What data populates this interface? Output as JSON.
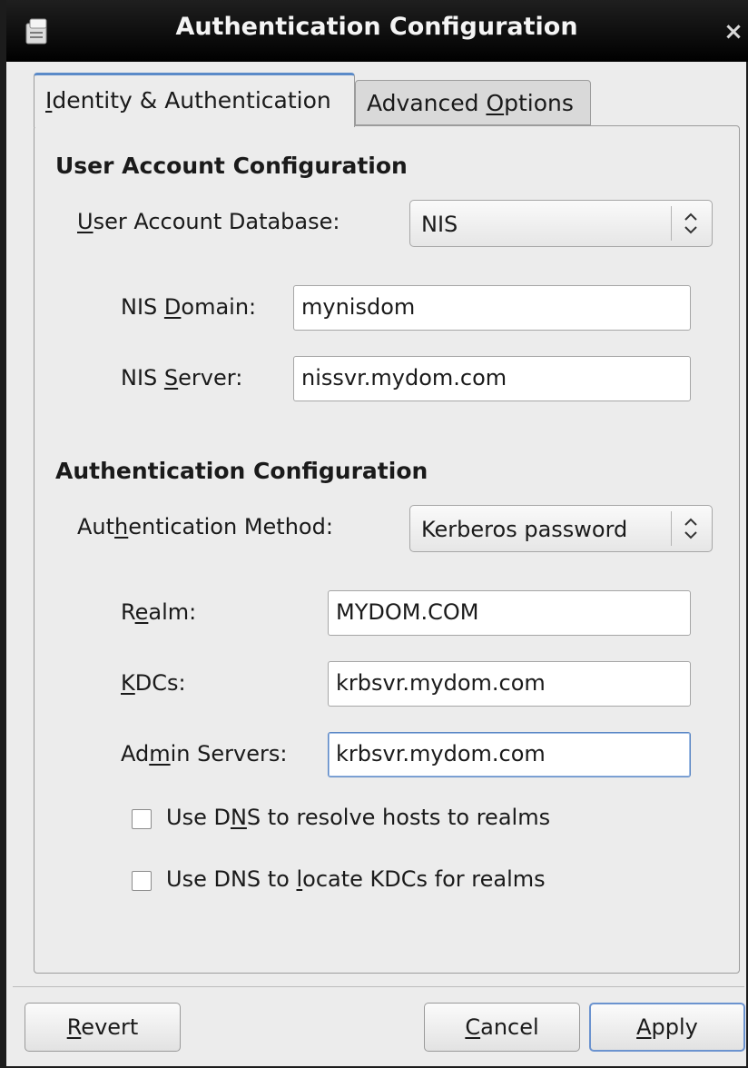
{
  "window": {
    "title": "Authentication Configuration",
    "close_glyph": "×"
  },
  "tabs": [
    {
      "pre": "",
      "key": "I",
      "post": "dentity & Authentication"
    },
    {
      "pre": "Advanced ",
      "key": "O",
      "post": "ptions"
    }
  ],
  "user_account": {
    "section_title": "User Account Configuration",
    "db_label": {
      "pre": "",
      "key": "U",
      "post": "ser Account Database:"
    },
    "db_value": "NIS",
    "nis_domain_label": {
      "pre": "NIS ",
      "key": "D",
      "post": "omain:"
    },
    "nis_domain_value": "mynisdom",
    "nis_server_label": {
      "pre": "NIS ",
      "key": "S",
      "post": "erver:"
    },
    "nis_server_value": "nissvr.mydom.com"
  },
  "authentication": {
    "section_title": "Authentication Configuration",
    "method_label": {
      "pre": "Aut",
      "key": "h",
      "post": "entication Method:"
    },
    "method_value": "Kerberos password",
    "realm_label": {
      "pre": "R",
      "key": "e",
      "post": "alm:"
    },
    "realm_value": "MYDOM.COM",
    "kdcs_label": {
      "pre": "",
      "key": "K",
      "post": "DCs:"
    },
    "kdcs_value": "krbsvr.mydom.com",
    "admin_label": {
      "pre": "Ad",
      "key": "m",
      "post": "in Servers:"
    },
    "admin_value": "krbsvr.mydom.com",
    "dns_realms": {
      "pre": "Use D",
      "key": "N",
      "post": "S to resolve hosts to realms",
      "checked": false
    },
    "dns_kdcs": {
      "pre": "Use DNS to ",
      "key": "l",
      "post": "ocate KDCs for realms",
      "checked": false
    }
  },
  "buttons": {
    "revert": {
      "pre": "",
      "key": "R",
      "post": "evert"
    },
    "cancel": {
      "pre": "",
      "key": "C",
      "post": "ancel"
    },
    "apply": {
      "pre": "",
      "key": "A",
      "post": "pply"
    }
  },
  "colors": {
    "accent": "#5a8ac8",
    "titlebar": "#000000",
    "background": "#ececec"
  },
  "icons": {
    "window": "app-window-icon",
    "combo": "updown-arrows-icon",
    "close": "close-icon"
  }
}
